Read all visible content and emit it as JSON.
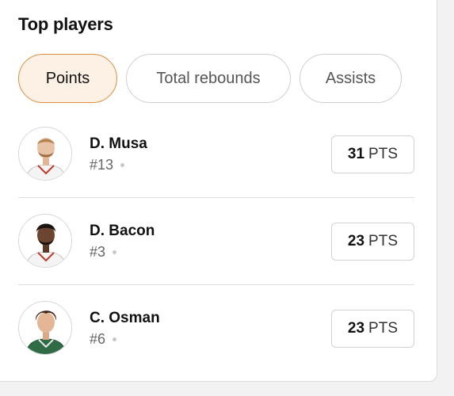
{
  "title": "Top players",
  "tabs": [
    {
      "label": "Points",
      "active": true
    },
    {
      "label": "Total rebounds",
      "active": false
    },
    {
      "label": "Assists",
      "active": false
    }
  ],
  "players": [
    {
      "name": "D. Musa",
      "number": "#13",
      "value": "31",
      "unit": "PTS"
    },
    {
      "name": "D. Bacon",
      "number": "#3",
      "value": "23",
      "unit": "PTS"
    },
    {
      "name": "C. Osman",
      "number": "#6",
      "value": "23",
      "unit": "PTS"
    }
  ],
  "colors": {
    "active_tab_bg": "#fdf1e5",
    "active_tab_border": "#d98f3f",
    "jersey_white": "#f4f4f4",
    "jersey_green": "#2f6b45"
  }
}
